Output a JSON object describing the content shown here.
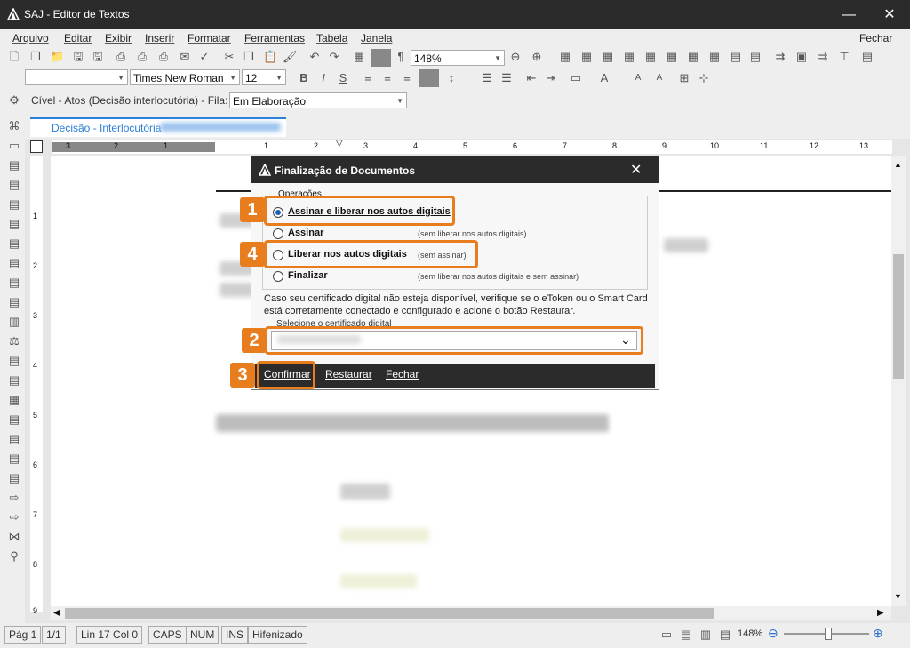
{
  "window": {
    "title": "SAJ - Editor de Textos",
    "minimize": "—",
    "maximize": "☐",
    "close": "✕"
  },
  "menu": {
    "items": [
      "Arquivo",
      "Editar",
      "Exibir",
      "Inserir",
      "Formatar",
      "Ferramentas",
      "Tabela",
      "Janela"
    ],
    "close_label": "Fechar"
  },
  "toolbar": {
    "font": "Times New Roman",
    "font_size": "12",
    "zoom": "148%"
  },
  "fila": {
    "case_label": "Cível - Atos (Decisão interlocutória) - Fila:",
    "queue_value": "Em Elaboração"
  },
  "doc_tab": {
    "label": "Decisão - Interlocutória"
  },
  "ruler": {
    "marks": [
      "3",
      "2",
      "1",
      "1",
      "2",
      "3",
      "4",
      "5",
      "6",
      "7",
      "8",
      "9",
      "10",
      "11",
      "12",
      "13"
    ]
  },
  "vruler": {
    "marks": [
      "1",
      "2",
      "3",
      "4",
      "5",
      "6",
      "7",
      "8",
      "9"
    ]
  },
  "dialog": {
    "title": "Finalização de Documentos",
    "close": "✕",
    "group_label": "Operações",
    "options": [
      {
        "label": "Assinar e liberar nos autos digitais",
        "note": "",
        "selected": true
      },
      {
        "label": "Assinar",
        "note": "(sem liberar nos autos digitais)",
        "selected": false
      },
      {
        "label": "Liberar nos autos digitais",
        "note": "(sem assinar)",
        "selected": false
      },
      {
        "label": "Finalizar",
        "note": "(sem liberar nos autos digitais e sem assinar)",
        "selected": false
      }
    ],
    "info": "Caso seu certificado digital não esteja disponível, verifique se o eToken ou o Smart Card está corretamente conectado e configurado e acione o botão Restaurar.",
    "cert_label": "Selecione o certificado digital",
    "buttons": {
      "confirm": "Confirmar",
      "restore": "Restaurar",
      "close": "Fechar"
    }
  },
  "badges": [
    "1",
    "2",
    "3",
    "4"
  ],
  "status": {
    "page": "Pág 1",
    "pages": "1/1",
    "pos": "Lin 17  Col 0",
    "caps": "CAPS",
    "num": "NUM",
    "ins": "INS",
    "hyph": "Hifenizado",
    "zoom": "148%"
  },
  "colors": {
    "accent": "#e87d1e",
    "title_bg": "#2b2b2b",
    "tab_border": "#2b7fd8"
  }
}
